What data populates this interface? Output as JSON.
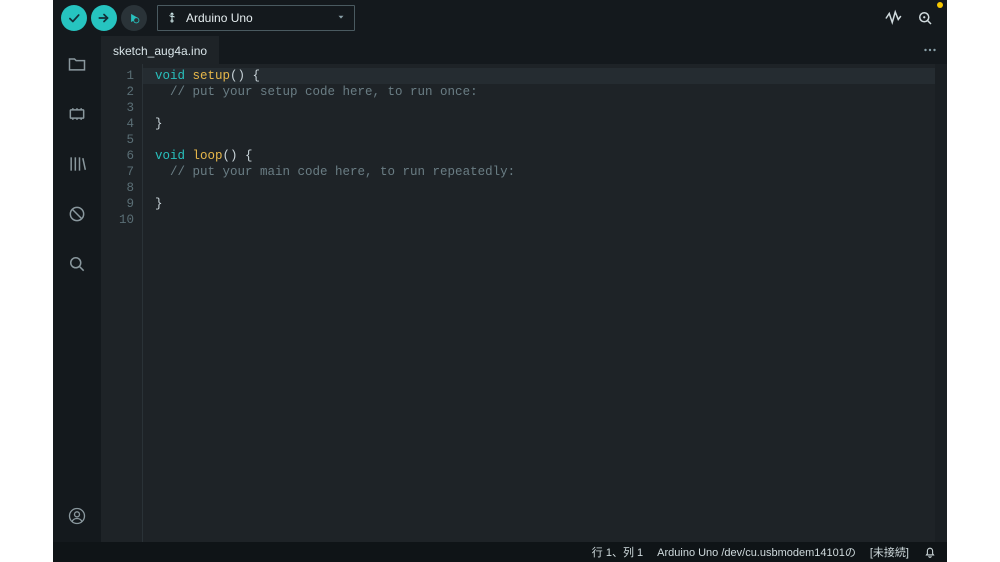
{
  "toolbar": {
    "board_label": "Arduino Uno"
  },
  "tabs": {
    "active": "sketch_aug4a.ino"
  },
  "code": {
    "lines": [
      [
        {
          "t": "kw",
          "v": "void"
        },
        {
          "t": "sp",
          "v": " "
        },
        {
          "t": "fn",
          "v": "setup"
        },
        {
          "t": "punc",
          "v": "() {"
        }
      ],
      [
        {
          "t": "sp",
          "v": "  "
        },
        {
          "t": "cmt",
          "v": "// put your setup code here, to run once:"
        }
      ],
      [],
      [
        {
          "t": "punc",
          "v": "}"
        }
      ],
      [],
      [
        {
          "t": "kw",
          "v": "void"
        },
        {
          "t": "sp",
          "v": " "
        },
        {
          "t": "fn",
          "v": "loop"
        },
        {
          "t": "punc",
          "v": "() {"
        }
      ],
      [
        {
          "t": "sp",
          "v": "  "
        },
        {
          "t": "cmt",
          "v": "// put your main code here, to run repeatedly:"
        }
      ],
      [],
      [
        {
          "t": "punc",
          "v": "}"
        }
      ],
      []
    ],
    "current_line_index": 0
  },
  "status": {
    "linecol": "行 1、列 1",
    "board_port": "Arduino Uno /dev/cu.usbmodem14101の",
    "conn": "[未接続]"
  }
}
